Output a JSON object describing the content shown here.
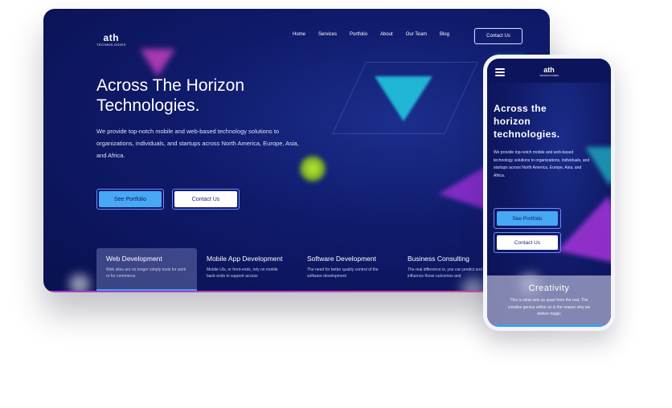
{
  "desktop": {
    "logo": {
      "mark": "ath",
      "sub": "TECHNOLOGIES"
    },
    "nav": [
      "Home",
      "Services",
      "Portfolio",
      "About",
      "Our Team",
      "Blog"
    ],
    "nav_contact": "Contact Us",
    "hero": {
      "title_line1": "Across The Horizon",
      "title_line2": "Technologies.",
      "description": "We provide top-notch mobile and web-based technology solutions to organizations, individuals, and startups across North America, Europe, Asia, and Africa."
    },
    "buttons": {
      "portfolio": "See Portfolio",
      "contact": "Contact Us"
    },
    "services": [
      {
        "title": "Web Development",
        "text": "Web sites are no longer simply tools for work or for commerce."
      },
      {
        "title": "Mobile App Development",
        "text": "Mobile UIs, or front-ends, rely on mobile back-ends to support access"
      },
      {
        "title": "Software Development",
        "text": "The need for better quality control of the software development"
      },
      {
        "title": "Business Consulting",
        "text": "The real difference is, you can predict and influence those outcomes and"
      }
    ]
  },
  "mobile": {
    "logo": {
      "mark": "ath",
      "sub": "TECHNOLOGIES"
    },
    "hero": {
      "title_line1": "Across the",
      "title_line2": "horizon",
      "title_line3": "technologies.",
      "description": "We provide top-notch mobile and web-based technology solutions to organizations, individuals, and startups across North America, Europe, Asia, and Africa."
    },
    "buttons": {
      "portfolio": "See Portfolio",
      "contact": "Contact Us"
    },
    "card": {
      "title": "Creativity",
      "text": "This is what sets us apart from the rest. The creative genius within us is the reason why we deliver magic"
    }
  },
  "colors": {
    "background": "#0f1a6a",
    "primary_button": "#47a8f5",
    "active_underline": "#3ea0f2",
    "accent_magenta": "#c33fc0",
    "accent_cyan": "#22c6de",
    "accent_purple": "#9a2fd7",
    "accent_lime": "#b6ef38"
  },
  "icons": {
    "menu": "hamburger-menu-icon"
  }
}
